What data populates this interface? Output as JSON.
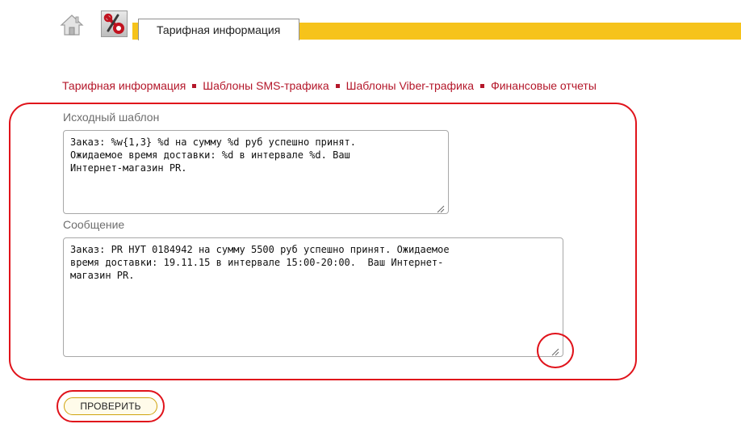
{
  "header": {
    "tab_label": "Тарифная информация",
    "accent_color": "#f6c31b"
  },
  "nav": {
    "items": [
      {
        "label": "Тарифная информация"
      },
      {
        "label": "Шаблоны SMS-трафика"
      },
      {
        "label": "Шаблоны Viber-трафика"
      },
      {
        "label": "Финансовые отчеты"
      }
    ],
    "link_color": "#b4172a"
  },
  "form": {
    "source_label": "Исходный шаблон",
    "source_text": "Заказ: %w{1,3} %d на сумму %d руб успешно принят.\nОжидаемое время доставки: %d в интервале %d. Ваш\nИнтернет-магазин PR.",
    "message_label": "Сообщение",
    "message_text": "Заказ: PR НУТ 0184942 на сумму 5500 руб успешно принят. Ожидаемое\nвремя доставки: 19.11.15 в интервале 15:00-20:00.  Ваш Интернет-\nмагазин PR.",
    "check_button_label": "ПРОВЕРИТЬ"
  },
  "icons": {
    "home": "home-icon",
    "tools": "tools-icon",
    "resize": "resize-grip-icon"
  },
  "annotation_color": "#e0131b"
}
